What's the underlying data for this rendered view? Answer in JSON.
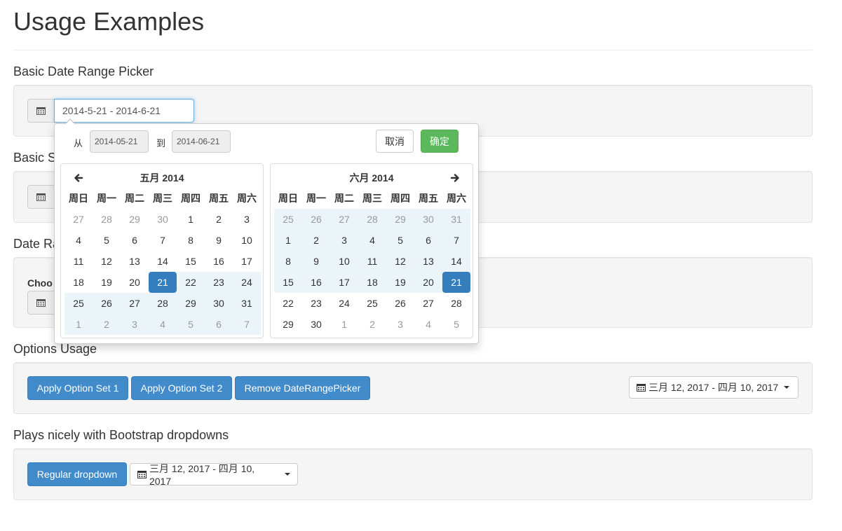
{
  "page": {
    "title": "Usage Examples"
  },
  "sections": {
    "basic_range": {
      "heading": "Basic Date Range Picker",
      "value": "2014-5-21 - 2014-6-21"
    },
    "basic_single": {
      "heading_visible": "Basic S"
    },
    "date_range": {
      "heading_visible": "Date Ra",
      "label_visible": "Choo"
    },
    "options": {
      "heading": "Options Usage",
      "buttons": [
        "Apply Option Set 1",
        "Apply Option Set 2",
        "Remove DateRangePicker"
      ],
      "range_label": "三月 12, 2017 - 四月 10, 2017"
    },
    "dropdowns": {
      "heading": "Plays nicely with Bootstrap dropdowns",
      "button": "Regular dropdown",
      "range_label": "三月 12, 2017 - 四月 10, 2017"
    }
  },
  "picker": {
    "from_label": "从",
    "to_label": "到",
    "from_value": "2014-05-21",
    "to_value": "2014-06-21",
    "cancel_label": "取消",
    "ok_label": "确定",
    "weekdays": [
      "周日",
      "周一",
      "周二",
      "周三",
      "周四",
      "周五",
      "周六"
    ],
    "calendars": [
      {
        "month_title": "五月 2014",
        "days": [
          {
            "d": "27",
            "s": "off"
          },
          {
            "d": "28",
            "s": "off"
          },
          {
            "d": "29",
            "s": "off"
          },
          {
            "d": "30",
            "s": "off"
          },
          {
            "d": "1",
            "s": ""
          },
          {
            "d": "2",
            "s": ""
          },
          {
            "d": "3",
            "s": ""
          },
          {
            "d": "4",
            "s": ""
          },
          {
            "d": "5",
            "s": ""
          },
          {
            "d": "6",
            "s": ""
          },
          {
            "d": "7",
            "s": ""
          },
          {
            "d": "8",
            "s": ""
          },
          {
            "d": "9",
            "s": ""
          },
          {
            "d": "10",
            "s": ""
          },
          {
            "d": "11",
            "s": ""
          },
          {
            "d": "12",
            "s": ""
          },
          {
            "d": "13",
            "s": ""
          },
          {
            "d": "14",
            "s": ""
          },
          {
            "d": "15",
            "s": ""
          },
          {
            "d": "16",
            "s": ""
          },
          {
            "d": "17",
            "s": ""
          },
          {
            "d": "18",
            "s": ""
          },
          {
            "d": "19",
            "s": ""
          },
          {
            "d": "20",
            "s": ""
          },
          {
            "d": "21",
            "s": "active"
          },
          {
            "d": "22",
            "s": "inrange"
          },
          {
            "d": "23",
            "s": "inrange"
          },
          {
            "d": "24",
            "s": "inrange"
          },
          {
            "d": "25",
            "s": "inrange"
          },
          {
            "d": "26",
            "s": "inrange"
          },
          {
            "d": "27",
            "s": "inrange"
          },
          {
            "d": "28",
            "s": "inrange"
          },
          {
            "d": "29",
            "s": "inrange"
          },
          {
            "d": "30",
            "s": "inrange"
          },
          {
            "d": "31",
            "s": "inrange"
          },
          {
            "d": "1",
            "s": "off inrange"
          },
          {
            "d": "2",
            "s": "off inrange"
          },
          {
            "d": "3",
            "s": "off inrange"
          },
          {
            "d": "4",
            "s": "off inrange"
          },
          {
            "d": "5",
            "s": "off inrange"
          },
          {
            "d": "6",
            "s": "off inrange"
          },
          {
            "d": "7",
            "s": "off inrange"
          }
        ]
      },
      {
        "month_title": "六月 2014",
        "days": [
          {
            "d": "25",
            "s": "off inrange"
          },
          {
            "d": "26",
            "s": "off inrange"
          },
          {
            "d": "27",
            "s": "off inrange"
          },
          {
            "d": "28",
            "s": "off inrange"
          },
          {
            "d": "29",
            "s": "off inrange"
          },
          {
            "d": "30",
            "s": "off inrange"
          },
          {
            "d": "31",
            "s": "off inrange"
          },
          {
            "d": "1",
            "s": "inrange"
          },
          {
            "d": "2",
            "s": "inrange"
          },
          {
            "d": "3",
            "s": "inrange"
          },
          {
            "d": "4",
            "s": "inrange"
          },
          {
            "d": "5",
            "s": "inrange"
          },
          {
            "d": "6",
            "s": "inrange"
          },
          {
            "d": "7",
            "s": "inrange"
          },
          {
            "d": "8",
            "s": "inrange"
          },
          {
            "d": "9",
            "s": "inrange"
          },
          {
            "d": "10",
            "s": "inrange"
          },
          {
            "d": "11",
            "s": "inrange"
          },
          {
            "d": "12",
            "s": "inrange"
          },
          {
            "d": "13",
            "s": "inrange"
          },
          {
            "d": "14",
            "s": "inrange"
          },
          {
            "d": "15",
            "s": "inrange"
          },
          {
            "d": "16",
            "s": "inrange"
          },
          {
            "d": "17",
            "s": "inrange"
          },
          {
            "d": "18",
            "s": "inrange"
          },
          {
            "d": "19",
            "s": "inrange"
          },
          {
            "d": "20",
            "s": "inrange"
          },
          {
            "d": "21",
            "s": "active"
          },
          {
            "d": "22",
            "s": ""
          },
          {
            "d": "23",
            "s": ""
          },
          {
            "d": "24",
            "s": ""
          },
          {
            "d": "25",
            "s": ""
          },
          {
            "d": "26",
            "s": ""
          },
          {
            "d": "27",
            "s": ""
          },
          {
            "d": "28",
            "s": ""
          },
          {
            "d": "29",
            "s": ""
          },
          {
            "d": "30",
            "s": ""
          },
          {
            "d": "1",
            "s": "off"
          },
          {
            "d": "2",
            "s": "off"
          },
          {
            "d": "3",
            "s": "off"
          },
          {
            "d": "4",
            "s": "off"
          },
          {
            "d": "5",
            "s": "off"
          }
        ]
      }
    ]
  },
  "colors": {
    "primary": "#428bca",
    "success": "#5cb85c",
    "active_day": "#357ebd",
    "in_range": "#ebf4f8",
    "well": "#f5f5f5"
  },
  "icons": {
    "calendar": "calendar-icon",
    "prev": "arrow-left-icon",
    "next": "arrow-right-icon",
    "caret": "caret-down-icon"
  }
}
